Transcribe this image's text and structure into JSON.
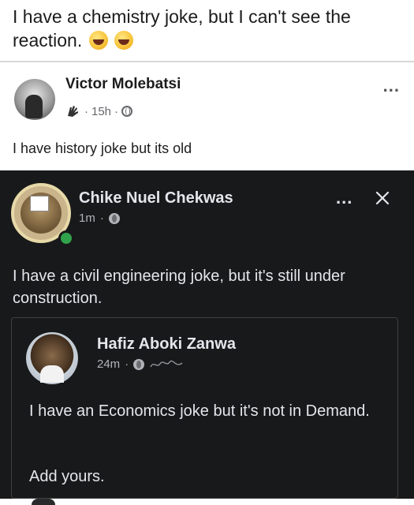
{
  "caption": {
    "text": "I have a chemistry joke, but I can't see the reaction.",
    "emoji": [
      "laughing-face-icon",
      "laughing-face-icon"
    ]
  },
  "post1": {
    "author": "Victor Molebatsi",
    "time": "15h",
    "separator": "·",
    "text": "I have history joke but its old",
    "more_label": "..."
  },
  "post2": {
    "author": "Chike Nuel Chekwas",
    "time": "1m",
    "separator": "·",
    "more_label": "...",
    "text": "I have a civil engineering joke, but it's still under construction.",
    "shared": {
      "author": "Hafiz Aboki Zanwa",
      "time": "24m",
      "separator": "·",
      "text": "I have an Economics joke but it's not in Demand.",
      "text2": "Add yours."
    }
  },
  "colors": {
    "dark_bg": "#18191a",
    "dark_text": "#e4e6eb",
    "muted": "#65676b",
    "online": "#31a24c"
  }
}
